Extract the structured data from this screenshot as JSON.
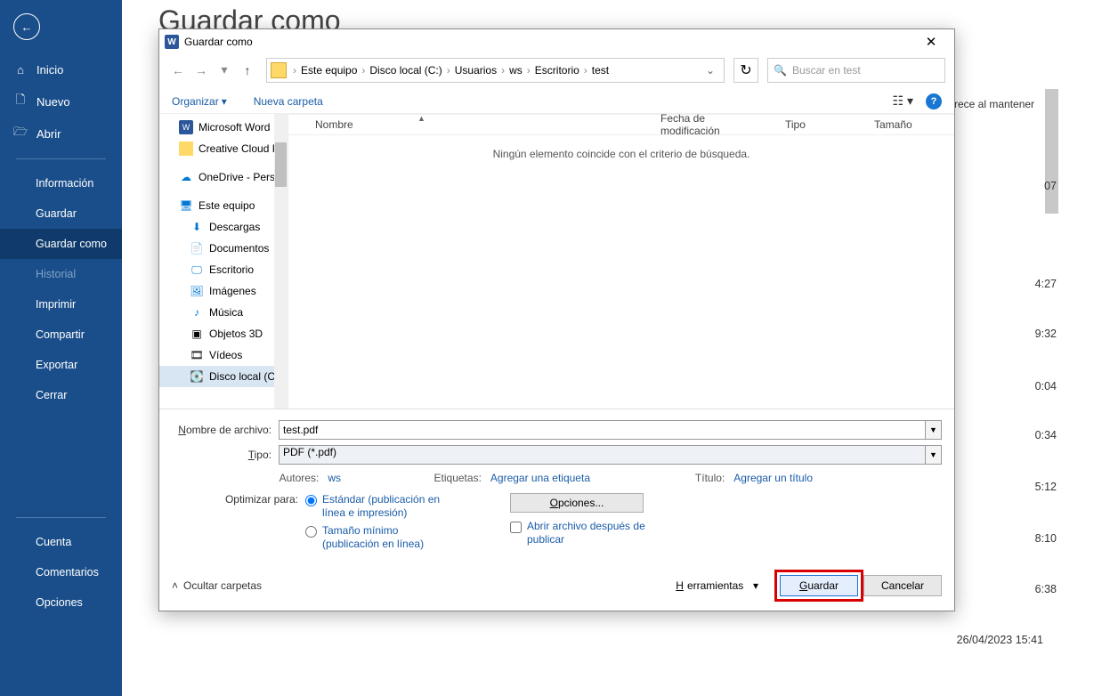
{
  "background": {
    "title": "Guardar como",
    "note_right": "rece al mantener",
    "times": [
      "07",
      "4:27",
      "9:32",
      "0:04",
      "0:34",
      "5:12",
      "8:10",
      "6:38"
    ],
    "timestamp_bottom": "26/04/2023 15:41"
  },
  "sidebar": {
    "items": [
      {
        "label": "Inicio",
        "icon": "home-icon"
      },
      {
        "label": "Nuevo",
        "icon": "new-icon"
      },
      {
        "label": "Abrir",
        "icon": "open-icon"
      }
    ],
    "sub": [
      {
        "label": "Información"
      },
      {
        "label": "Guardar"
      },
      {
        "label": "Guardar como",
        "selected": true
      },
      {
        "label": "Historial",
        "dim": true
      },
      {
        "label": "Imprimir"
      },
      {
        "label": "Compartir"
      },
      {
        "label": "Exportar"
      },
      {
        "label": "Cerrar"
      }
    ],
    "bottom": [
      {
        "label": "Cuenta"
      },
      {
        "label": "Comentarios"
      },
      {
        "label": "Opciones"
      }
    ]
  },
  "dialog": {
    "title": "Guardar como",
    "breadcrumb": [
      "Este equipo",
      "Disco local (C:)",
      "Usuarios",
      "ws",
      "Escritorio",
      "test"
    ],
    "search_placeholder": "Buscar en test",
    "organize": "Organizar",
    "new_folder": "Nueva carpeta",
    "columns": {
      "name": "Nombre",
      "date": "Fecha de modificación",
      "type": "Tipo",
      "size": "Tamaño"
    },
    "empty": "Ningún elemento coincide con el criterio de búsqueda.",
    "tree": [
      {
        "label": "Microsoft Word",
        "icon": "word",
        "lvl": 1
      },
      {
        "label": "Creative Cloud Fil",
        "icon": "cc",
        "lvl": 1
      },
      {
        "label": "OneDrive - Person",
        "icon": "onedrive",
        "lvl": 1
      },
      {
        "label": "Este equipo",
        "icon": "pc",
        "lvl": 1
      },
      {
        "label": "Descargas",
        "icon": "down",
        "lvl": 2
      },
      {
        "label": "Documentos",
        "icon": "doc",
        "lvl": 2
      },
      {
        "label": "Escritorio",
        "icon": "desk",
        "lvl": 2
      },
      {
        "label": "Imágenes",
        "icon": "img",
        "lvl": 2
      },
      {
        "label": "Música",
        "icon": "music",
        "lvl": 2
      },
      {
        "label": "Objetos 3D",
        "icon": "3d",
        "lvl": 2
      },
      {
        "label": "Vídeos",
        "icon": "video",
        "lvl": 2
      },
      {
        "label": "Disco local (C:)",
        "icon": "disk",
        "lvl": 2,
        "selected": true
      }
    ],
    "filename_label": "Nombre de archivo:",
    "filename": "test.pdf",
    "type_label": "Tipo:",
    "type_value": "PDF (*.pdf)",
    "authors_label": "Autores:",
    "authors": "ws",
    "tags_label": "Etiquetas:",
    "tags": "Agregar una etiqueta",
    "titlemeta_label": "Título:",
    "titlemeta": "Agregar un título",
    "optimize_label": "Optimizar para:",
    "opt_standard": "Estándar (publicación en línea e impresión)",
    "opt_minsize": "Tamaño mínimo (publicación en línea)",
    "options_btn": "Opciones...",
    "open_after": "Abrir archivo después de publicar",
    "hide_folders": "Ocultar carpetas",
    "tools": "Herramientas",
    "save_btn": "Guardar",
    "cancel_btn": "Cancelar"
  }
}
